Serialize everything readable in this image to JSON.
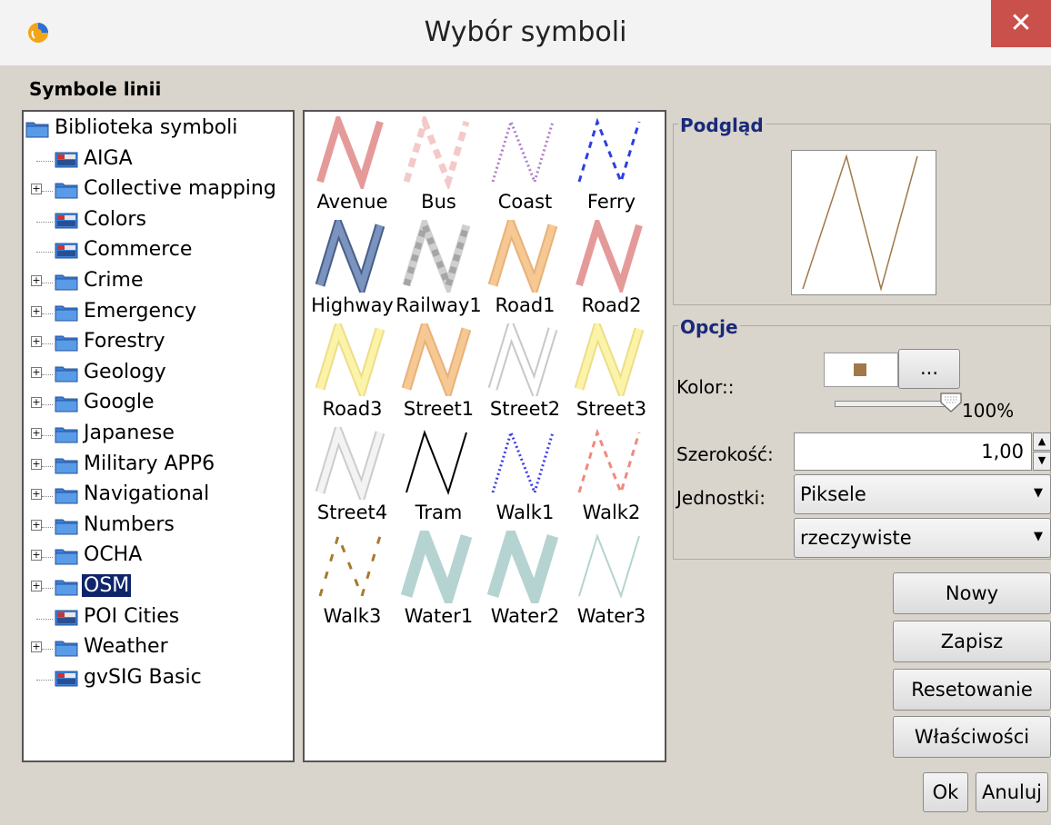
{
  "window": {
    "title": "Wybór symboli",
    "close_label": "✕"
  },
  "section_title": "Symbole linii",
  "tree": {
    "items": [
      {
        "label": "Biblioteka symboli",
        "type": "folder",
        "expandable": false
      },
      {
        "label": "AIGA",
        "type": "file",
        "expandable": false
      },
      {
        "label": "Collective mapping",
        "type": "folder",
        "expandable": true
      },
      {
        "label": "Colors",
        "type": "file",
        "expandable": false
      },
      {
        "label": "Commerce",
        "type": "file",
        "expandable": false
      },
      {
        "label": "Crime",
        "type": "folder",
        "expandable": true
      },
      {
        "label": "Emergency",
        "type": "folder",
        "expandable": true
      },
      {
        "label": "Forestry",
        "type": "folder",
        "expandable": true
      },
      {
        "label": "Geology",
        "type": "folder",
        "expandable": true
      },
      {
        "label": "Google",
        "type": "folder",
        "expandable": true
      },
      {
        "label": "Japanese",
        "type": "folder",
        "expandable": true
      },
      {
        "label": "Military APP6",
        "type": "folder",
        "expandable": true
      },
      {
        "label": "Navigational",
        "type": "folder",
        "expandable": true
      },
      {
        "label": "Numbers",
        "type": "folder",
        "expandable": true
      },
      {
        "label": "OCHA",
        "type": "folder",
        "expandable": true
      },
      {
        "label": "OSM",
        "type": "folder",
        "expandable": true,
        "selected": true
      },
      {
        "label": "POI Cities",
        "type": "file",
        "expandable": false
      },
      {
        "label": "Weather",
        "type": "folder",
        "expandable": true
      },
      {
        "label": "gvSIG Basic",
        "type": "file",
        "expandable": false
      }
    ]
  },
  "symbols": [
    {
      "name": "Avenue",
      "style": "solid",
      "color": "#e59a9a",
      "edge": ""
    },
    {
      "name": "Bus",
      "style": "dash-wide",
      "color": "#f4c9c9",
      "edge": ""
    },
    {
      "name": "Coast",
      "style": "dotted",
      "color": "#b07cc8",
      "edge": ""
    },
    {
      "name": "Ferry",
      "style": "dashed",
      "color": "#2d3fe0",
      "edge": ""
    },
    {
      "name": "Highway",
      "style": "cased",
      "color": "#7a93bf",
      "edge": "#4a5e88"
    },
    {
      "name": "Railway1",
      "style": "rail",
      "color": "#a5a5a5",
      "edge": ""
    },
    {
      "name": "Road1",
      "style": "cased",
      "color": "#f6c893",
      "edge": "#e8b27a"
    },
    {
      "name": "Road2",
      "style": "solid",
      "color": "#e59a9a",
      "edge": ""
    },
    {
      "name": "Road3",
      "style": "cased",
      "color": "#fbf4a8",
      "edge": "#eedd88"
    },
    {
      "name": "Street1",
      "style": "cased",
      "color": "#f6c893",
      "edge": "#e8b27a"
    },
    {
      "name": "Street2",
      "style": "cased",
      "color": "#ffffff",
      "edge": "#c8c8c8"
    },
    {
      "name": "Street3",
      "style": "cased",
      "color": "#fbf4a8",
      "edge": "#eedd88"
    },
    {
      "name": "Street4",
      "style": "cased",
      "color": "#f3f3f3",
      "edge": "#cccccc"
    },
    {
      "name": "Tram",
      "style": "thin",
      "color": "#000000",
      "edge": ""
    },
    {
      "name": "Walk1",
      "style": "dotted",
      "color": "#3a3ee8",
      "edge": ""
    },
    {
      "name": "Walk2",
      "style": "dashed",
      "color": "#f08a80",
      "edge": ""
    },
    {
      "name": "Walk3",
      "style": "dash-brown",
      "color": "#a77a2e",
      "edge": ""
    },
    {
      "name": "Water1",
      "style": "solid-wide",
      "color": "#b5d3d1",
      "edge": ""
    },
    {
      "name": "Water2",
      "style": "solid-wide",
      "color": "#b5d3d1",
      "edge": ""
    },
    {
      "name": "Water3",
      "style": "thin",
      "color": "#b5d3d1",
      "edge": ""
    }
  ],
  "preview": {
    "label": "Podgląd",
    "stroke_color": "#a0784a"
  },
  "options": {
    "label": "Opcje",
    "color_label": "Kolor::",
    "color_value": "#a0784a",
    "more_button": "...",
    "opacity_percent": 100,
    "opacity_text": "100%",
    "width_label": "Szerokość:",
    "width_value": "1,00",
    "units_label": "Jednostki:",
    "units_value": "Piksele",
    "units_mode_value": "rzeczywiste"
  },
  "buttons": {
    "new": "Nowy",
    "save": "Zapisz",
    "reset": "Resetowanie",
    "properties": "Właściwości",
    "ok": "Ok",
    "cancel": "Anuluj"
  }
}
